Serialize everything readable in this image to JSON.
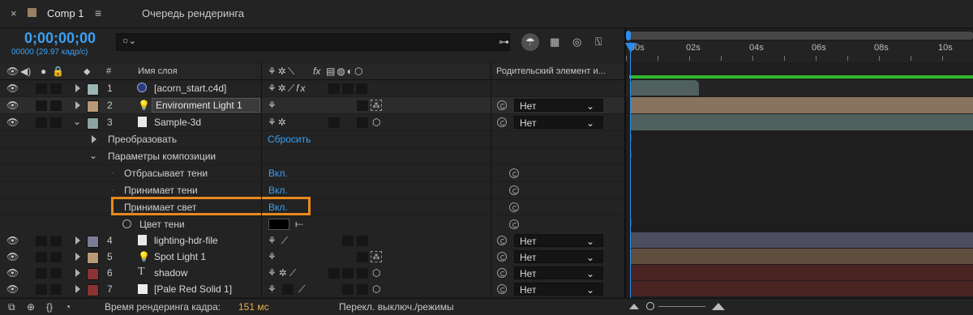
{
  "tabs": {
    "close_glyph": "×",
    "comp_label": "Comp 1",
    "menu_glyph": "≡",
    "render_queue_label": "Очередь рендеринга"
  },
  "time": {
    "timecode": "0;00;00;00",
    "frame_info": "00000 (29.97 кадр/с)"
  },
  "search": {
    "placeholder": ""
  },
  "columns": {
    "hash": "#",
    "layer_name": "Имя слоя",
    "fx": "fx",
    "parent": "Родительский элемент и..."
  },
  "ruler": {
    "ticks": [
      "00s",
      "02s",
      "04s",
      "06s",
      "08s",
      "10s"
    ]
  },
  "layers": [
    {
      "num": "1",
      "name": "[acorn_start.c4d]",
      "label_color": "#9bb6b4",
      "type_icon": "c4d-icon",
      "parent": ""
    },
    {
      "num": "2",
      "name": "Environment Light 1",
      "label_color": "#b89a76",
      "type_icon": "light-icon",
      "parent": "Нет"
    },
    {
      "num": "3",
      "name": "Sample-3d",
      "label_color": "#8aa3a0",
      "type_icon": "file-icon",
      "parent": "Нет"
    },
    {
      "num": "4",
      "name": "lighting-hdr-file",
      "label_color": "#7a7b96",
      "type_icon": "hdr-file-icon",
      "parent": "Нет"
    },
    {
      "num": "5",
      "name": "Spot Light 1",
      "label_color": "#b89a76",
      "type_icon": "light-icon",
      "parent": "Нет"
    },
    {
      "num": "6",
      "name": "shadow",
      "label_color": "#8b3232",
      "type_icon": "text-icon",
      "parent": "Нет"
    },
    {
      "num": "7",
      "name": "[Pale Red Solid 1]",
      "label_color": "#8b3232",
      "type_icon": "solid-icon",
      "parent": "Нет"
    }
  ],
  "properties": {
    "transform": "Преобразовать",
    "reset": "Сбросить",
    "composition_params": "Параметры композиции",
    "casts_shadows": "Отбрасывает тени",
    "casts_shadows_val": "Вкл.",
    "accepts_shadows": "Принимает тени",
    "accepts_shadows_val": "Вкл.",
    "accepts_light": "Принимает свет",
    "accepts_light_val": "Вкл.",
    "shadow_color": "Цвет тени"
  },
  "footer": {
    "render_time_label": "Время рендеринга кадра:",
    "render_time_value": "151 мс",
    "toggle_modes": "Перекл. выключ./режимы"
  },
  "colors": {
    "accent_blue": "#2d8ceb",
    "highlight_orange": "#e8891e",
    "work_area_green": "#2fb82f",
    "bar_tan": "#8a735e",
    "bar_teal": "#4f605e",
    "bar_slate": "#4c4d5e",
    "bar_red": "#4a2323"
  }
}
